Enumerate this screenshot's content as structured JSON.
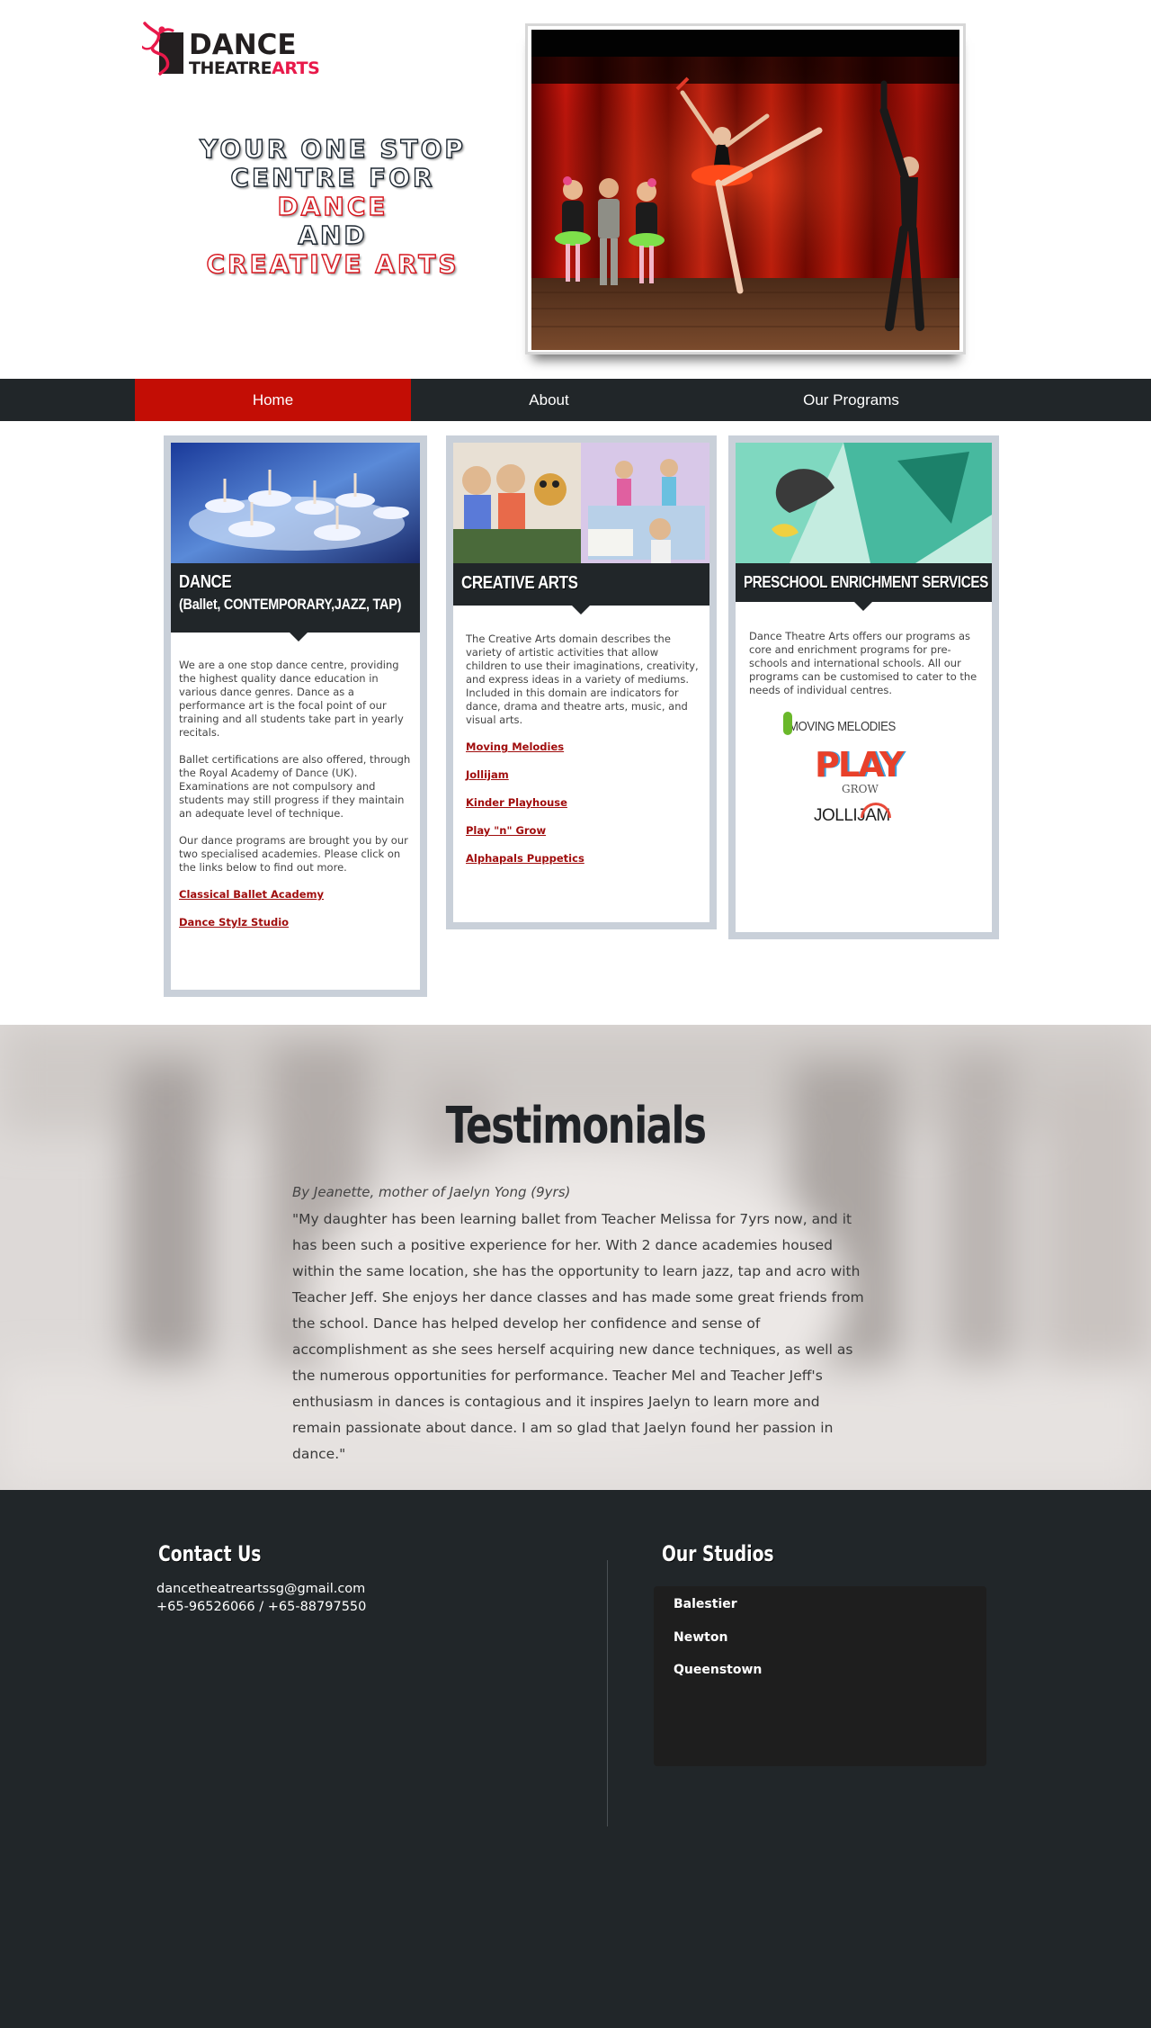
{
  "brand": {
    "logo_line1": "DANCE",
    "logo_line2_dark": "THEATRE",
    "logo_line2_accent": "ARTS",
    "accent_color": "#e8194a"
  },
  "tagline": {
    "line1": "YOUR ONE STOP",
    "line2": "CENTRE FOR",
    "line3": "DANCE",
    "line4": "AND",
    "line5": "CREATIVE ARTS"
  },
  "nav": {
    "items": [
      "Home",
      "About",
      "Our Programs"
    ],
    "active_color": "#c30d05",
    "bar_color": "#212629"
  },
  "cards": {
    "dance": {
      "title": "DANCE",
      "subtitle": "(Ballet, CONTEMPORARY,JAZZ, TAP)",
      "paragraphs": [
        "We are a one stop dance centre, providing the highest quality dance education in various dance genres.  Dance as a performance art is the focal point of our training and all students take part in yearly recitals.",
        "Ballet certifications are also offered, through the Royal Academy of Dance (UK). Examinations are not compulsory and students may still progress if they maintain an adequate level of technique.",
        "Our dance programs are brought you by our two specialised academies.  Please click on the links below to find out more."
      ],
      "links": [
        "Classical Ballet Academy",
        "Dance Stylz Studio"
      ]
    },
    "creative": {
      "title": "CREATIVE ARTS",
      "paragraph": "The Creative Arts domain describes the variety of artistic activities that allow children to use their imaginations, creativity, and express ideas in a variety of mediums. Included in this domain are indicators for dance, drama and theatre arts, music, and visual arts.",
      "links": [
        "Moving Melodies",
        "Jollijam",
        "Kinder Playhouse",
        "Play \"n\" Grow",
        "Alphapals Puppetics"
      ]
    },
    "preschool": {
      "title": "PRESCHOOL ENRICHMENT  SERVICES",
      "paragraph": "Dance Theatre Arts offers our programs as core and enrichment programs for pre-schools and international schools.   All our programs can be customised to cater to the needs of individual centres.",
      "logo_texts": [
        "MOVING MELODIES",
        "PLAY",
        "GROW",
        "JOLLIJAM"
      ]
    }
  },
  "testimonials": {
    "title": "Testimonials",
    "author": "By Jeanette, mother of Jaelyn Yong (9yrs)",
    "quote": "\"My daughter has been learning ballet from Teacher Melissa for 7yrs now, and it has been such a positive experience for her.  With 2 dance academies housed within the same location, she has the opportunity to learn jazz, tap and acro with Teacher Jeff.  She enjoys her dance classes and has made some great friends from the school.  Dance has helped develop her confidence and sense of accomplishment as she sees herself acquiring new dance techniques, as well as the numerous opportunities for performance.  Teacher Mel and Teacher Jeff's enthusiasm in dances is contagious and it inspires Jaelyn to learn more and remain passionate about dance.  I am so glad that Jaelyn found her passion in dance.\""
  },
  "footer": {
    "contact_heading": "Contact Us",
    "email": "dancetheatreartssg@gmail.com",
    "phone": "+65-96526066 / +65-88797550",
    "studios_heading": "Our Studios",
    "studios": [
      "Balestier",
      "Newton",
      "Queenstown"
    ]
  }
}
